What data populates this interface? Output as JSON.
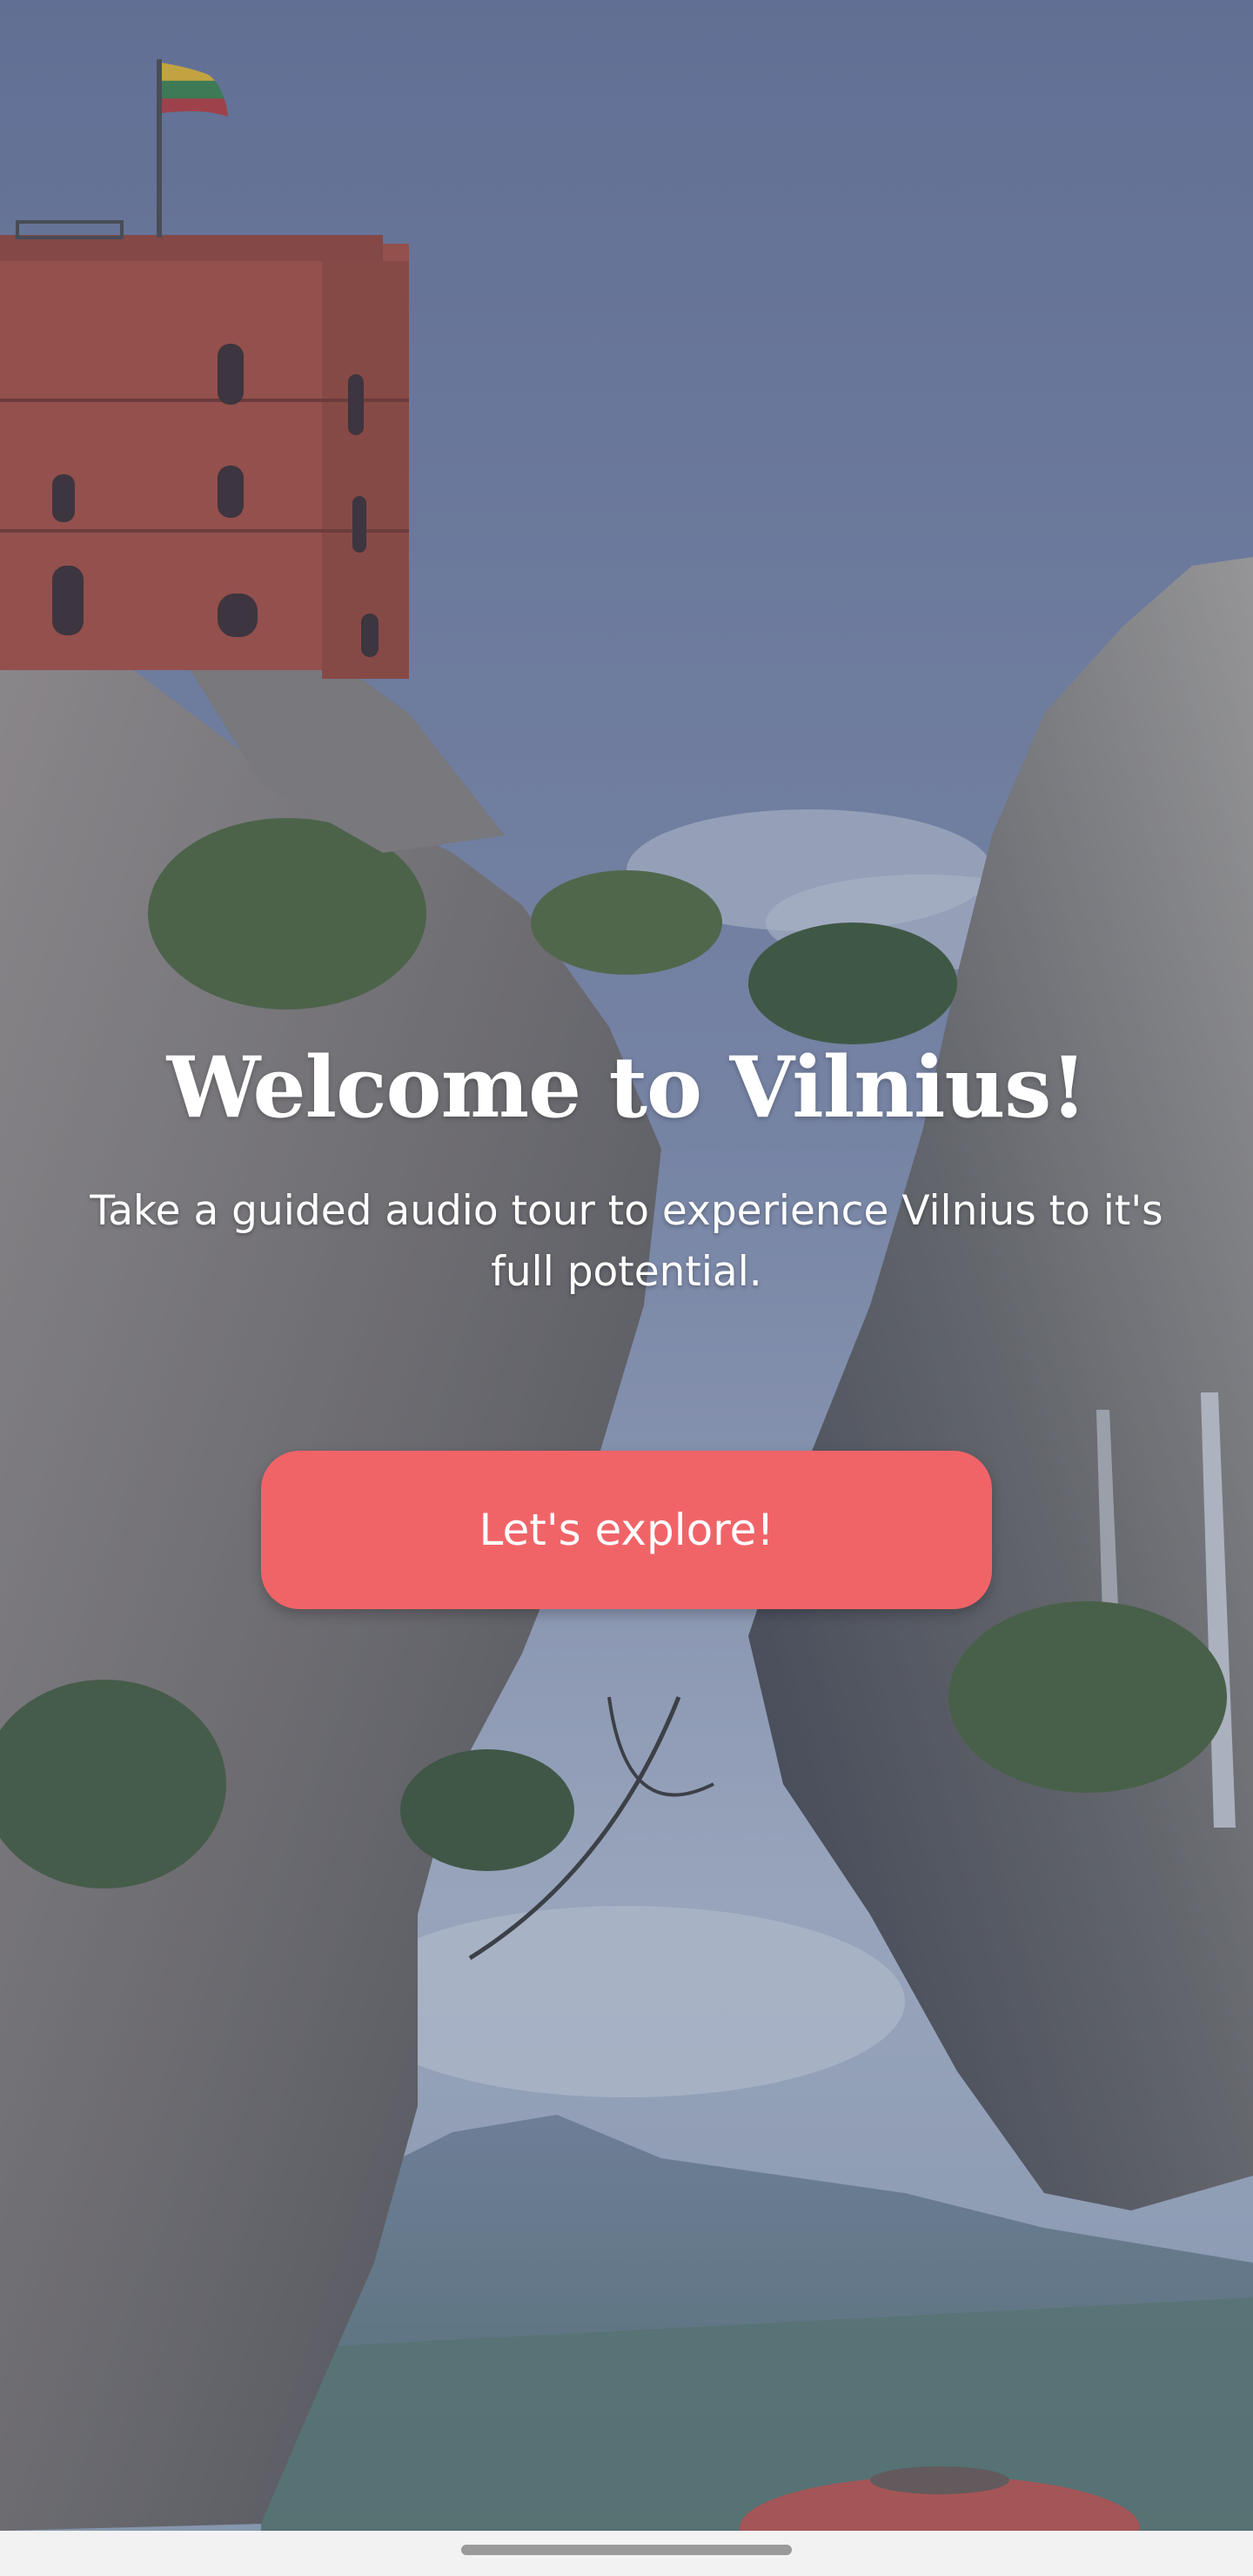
{
  "welcome": {
    "title": "Welcome to Vilnius!",
    "subtitle": "Take a guided audio tour to experience Vilnius to it's full potential.",
    "cta_label": "Let's explore!"
  },
  "colors": {
    "accent": "#f06468",
    "sky": "#6f7ea3",
    "nav_bar": "#f2f2f2",
    "text": "#ffffff"
  }
}
